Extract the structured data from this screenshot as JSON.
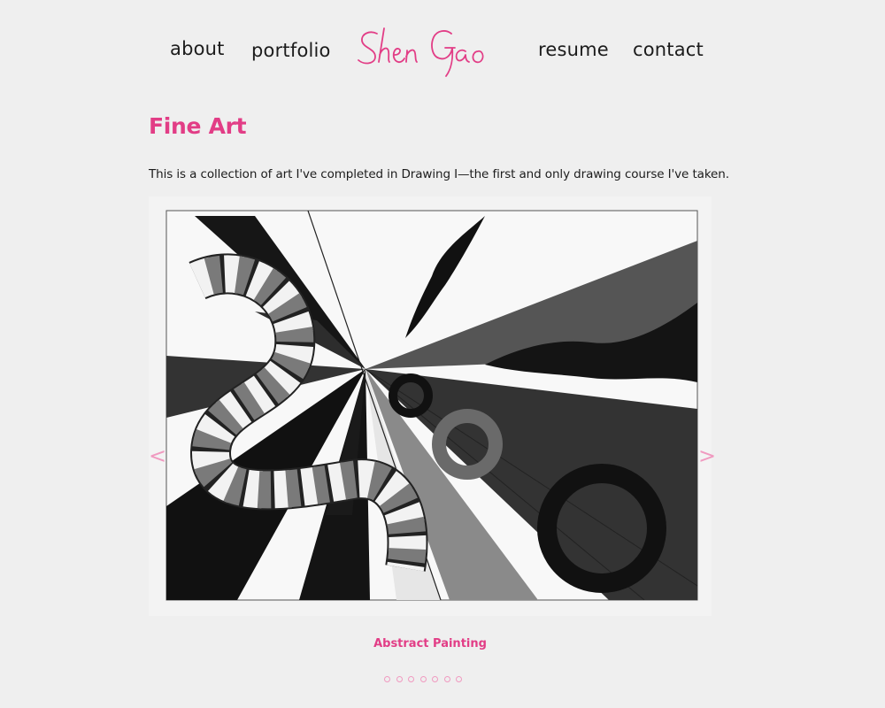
{
  "nav": {
    "about": "about",
    "portfolio": "portfolio",
    "resume": "resume",
    "contact": "contact",
    "logo_text": "Shen Gao"
  },
  "main": {
    "title": "Fine Art",
    "intro": "This is a collection of art I've completed in Drawing I—the first and only drawing course I've taken."
  },
  "slider": {
    "prev_label": "<",
    "next_label": ">",
    "caption": "Abstract Painting",
    "slide_count": 7,
    "artwork_icon": "abstract-painting-image"
  },
  "colors": {
    "accent": "#e23d86",
    "accent_light": "#f09ac0",
    "background": "#efefef"
  }
}
